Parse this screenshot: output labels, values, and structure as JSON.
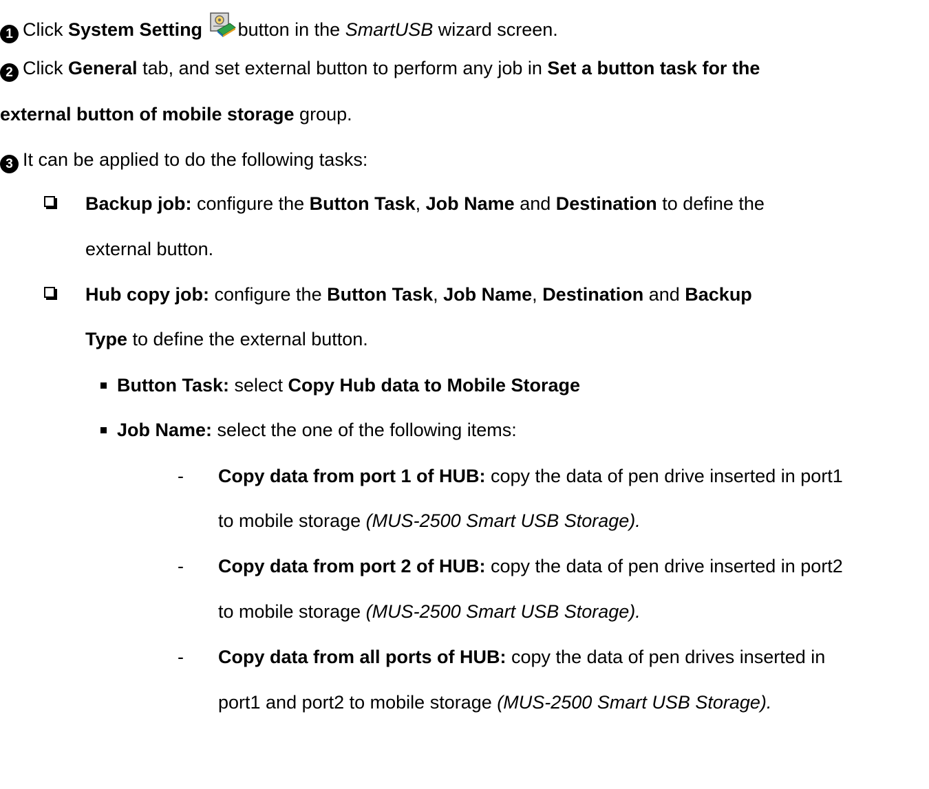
{
  "step1": {
    "marker": "1",
    "pre": "Click ",
    "bold1": "System Setting",
    "mid": "button in the ",
    "italic1": "SmartUSB",
    "post": " wizard screen."
  },
  "step2": {
    "marker": "2",
    "line1_pre": "Click ",
    "line1_bold1": "General",
    "line1_mid": " tab, and set external button to perform any job in ",
    "line1_bold2": "Set a button task for the",
    "line2_bold": "external button of mobile storage",
    "line2_post": " group."
  },
  "step3": {
    "marker": "3",
    "text": "It can be applied to do the following tasks:"
  },
  "backup_job": {
    "bold1": "Backup job:",
    "t1": " configure the ",
    "bold2": "Button Task",
    "t2": ", ",
    "bold3": "Job Name",
    "t3": " and ",
    "bold4": "Destination",
    "t4": " to define the",
    "line2": "external button."
  },
  "hub_copy_job": {
    "bold1": "Hub copy job:",
    "t1": " configure the ",
    "bold2": "Button Task",
    "t2": ", ",
    "bold3": "Job Name",
    "t3": ", ",
    "bold4": "Destination",
    "t4": " and ",
    "bold5": "Backup",
    "line2_bold": "Type",
    "line2_post": " to define the external button."
  },
  "button_task": {
    "bold1": "Button Task:",
    "t1": " select ",
    "bold2": "Copy Hub data to Mobile Storage"
  },
  "job_name": {
    "bold1": "Job Name:",
    "t1": " select the one of the following items:"
  },
  "items": [
    {
      "dash": "-",
      "bold": "Copy data from port 1 of HUB:",
      "text": " copy the data of pen drive inserted in port1",
      "line2": "to mobile storage ",
      "italic": "(MUS-2500 Smart USB Storage)."
    },
    {
      "dash": "-",
      "bold": "Copy data from port 2 of HUB:",
      "text": " copy the data of pen drive inserted in port2",
      "line2": "to mobile storage ",
      "italic": "(MUS-2500 Smart USB Storage)."
    },
    {
      "dash": "-",
      "bold": "Copy data from all ports of HUB:",
      "text": " copy the data of pen drives inserted in",
      "line2": "port1 and port2 to mobile storage ",
      "italic": "(MUS-2500 Smart USB Storage)."
    }
  ],
  "icons": {
    "system_setting": "system-setting-icon",
    "checkbox": "checkbox-icon",
    "square_bullet": "square-bullet-icon"
  }
}
